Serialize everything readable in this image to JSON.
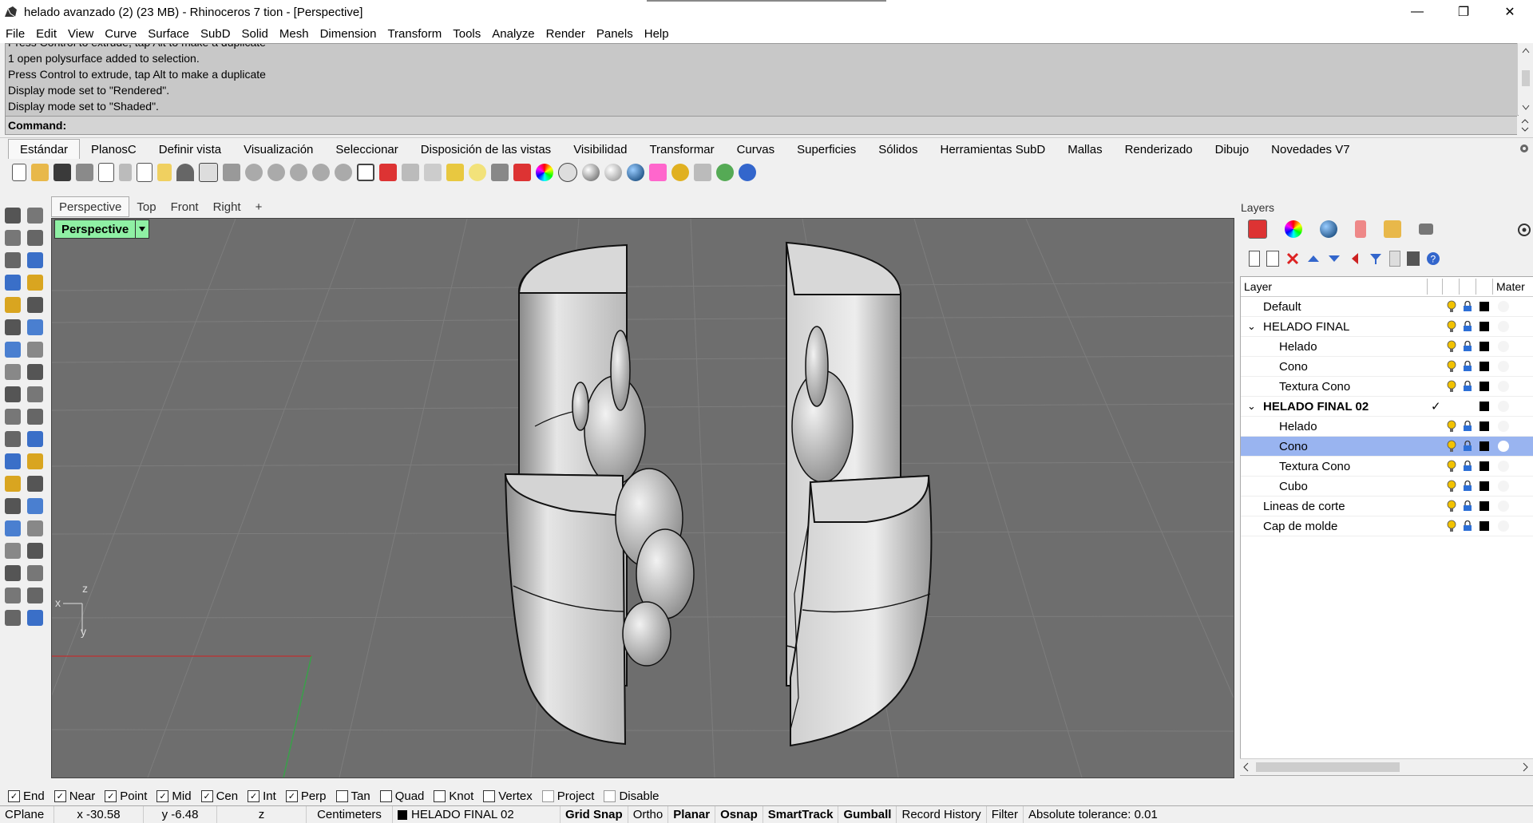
{
  "window": {
    "title": "helado avanzado (2) (23 MB) - Rhinoceros 7 tion - [Perspective]",
    "minimize": "—",
    "maximize": "❐",
    "close": "✕"
  },
  "menu": [
    "File",
    "Edit",
    "View",
    "Curve",
    "Surface",
    "SubD",
    "Solid",
    "Mesh",
    "Dimension",
    "Transform",
    "Tools",
    "Analyze",
    "Render",
    "Panels",
    "Help"
  ],
  "history": {
    "lines": [
      "Press Control to extrude, tap Alt to make a duplicate",
      "1 open polysurface added to selection.",
      "Press Control to extrude, tap Alt to make a duplicate",
      "Display mode set to \"Rendered\".",
      "Display mode set to \"Shaded\"."
    ]
  },
  "command": {
    "label": "Command:",
    "value": ""
  },
  "toolbar_tabs": [
    "Estándar",
    "PlanosC",
    "Definir vista",
    "Visualización",
    "Seleccionar",
    "Disposición de las vistas",
    "Visibilidad",
    "Transformar",
    "Curvas",
    "Superficies",
    "Sólidos",
    "Herramientas SubD",
    "Mallas",
    "Renderizado",
    "Dibujo",
    "Novedades V7"
  ],
  "viewport": {
    "tabs": [
      "Perspective",
      "Top",
      "Front",
      "Right",
      "+"
    ],
    "label": "Perspective",
    "axis": {
      "x": "x",
      "y": "y",
      "z": "z"
    }
  },
  "layers": {
    "title": "Layers",
    "header": {
      "layer": "Layer",
      "material": "Mater"
    },
    "rows": [
      {
        "name": "Default",
        "indent": 0,
        "expander": "",
        "bold": false,
        "current": false,
        "selected": false
      },
      {
        "name": "HELADO FINAL",
        "indent": 0,
        "expander": "⌄",
        "bold": false,
        "current": false,
        "selected": false
      },
      {
        "name": "Helado",
        "indent": 1,
        "expander": "",
        "bold": false,
        "current": false,
        "selected": false
      },
      {
        "name": "Cono",
        "indent": 1,
        "expander": "",
        "bold": false,
        "current": false,
        "selected": false
      },
      {
        "name": "Textura Cono",
        "indent": 1,
        "expander": "",
        "bold": false,
        "current": false,
        "selected": false
      },
      {
        "name": "HELADO FINAL 02",
        "indent": 0,
        "expander": "⌄",
        "bold": true,
        "current": true,
        "selected": false
      },
      {
        "name": "Helado",
        "indent": 1,
        "expander": "",
        "bold": false,
        "current": false,
        "selected": false
      },
      {
        "name": "Cono",
        "indent": 1,
        "expander": "",
        "bold": false,
        "current": false,
        "selected": true
      },
      {
        "name": "Textura Cono",
        "indent": 1,
        "expander": "",
        "bold": false,
        "current": false,
        "selected": false
      },
      {
        "name": "Cubo",
        "indent": 1,
        "expander": "",
        "bold": false,
        "current": false,
        "selected": false
      },
      {
        "name": "Lineas de corte",
        "indent": 0,
        "expander": "",
        "bold": false,
        "current": false,
        "selected": false
      },
      {
        "name": "Cap de molde",
        "indent": 0,
        "expander": "",
        "bold": false,
        "current": false,
        "selected": false
      }
    ],
    "current_mark": "✓"
  },
  "osnap": [
    {
      "label": "End",
      "checked": true
    },
    {
      "label": "Near",
      "checked": true
    },
    {
      "label": "Point",
      "checked": true
    },
    {
      "label": "Mid",
      "checked": true
    },
    {
      "label": "Cen",
      "checked": true
    },
    {
      "label": "Int",
      "checked": true
    },
    {
      "label": "Perp",
      "checked": true
    },
    {
      "label": "Tan",
      "checked": false
    },
    {
      "label": "Quad",
      "checked": false
    },
    {
      "label": "Knot",
      "checked": false
    },
    {
      "label": "Vertex",
      "checked": false
    },
    {
      "label": "Project",
      "checked": false
    },
    {
      "label": "Disable",
      "checked": false
    }
  ],
  "status": {
    "cplane": "CPlane",
    "x": "x -30.58",
    "y": "y -6.48",
    "z": "z",
    "units": "Centimeters",
    "layer": "HELADO FINAL 02",
    "grid_snap": "Grid Snap",
    "ortho": "Ortho",
    "planar": "Planar",
    "osnap": "Osnap",
    "smarttrack": "SmartTrack",
    "gumball": "Gumball",
    "record_history": "Record History",
    "filter": "Filter",
    "tolerance": "Absolute tolerance: 0.01"
  },
  "colors": {
    "viewport_bg": "#6e6e6e",
    "viewport_label": "#8ff0a4",
    "selected_row": "#99b4f0",
    "bulb": "#f2c200",
    "lock": "#2d6fd6"
  }
}
